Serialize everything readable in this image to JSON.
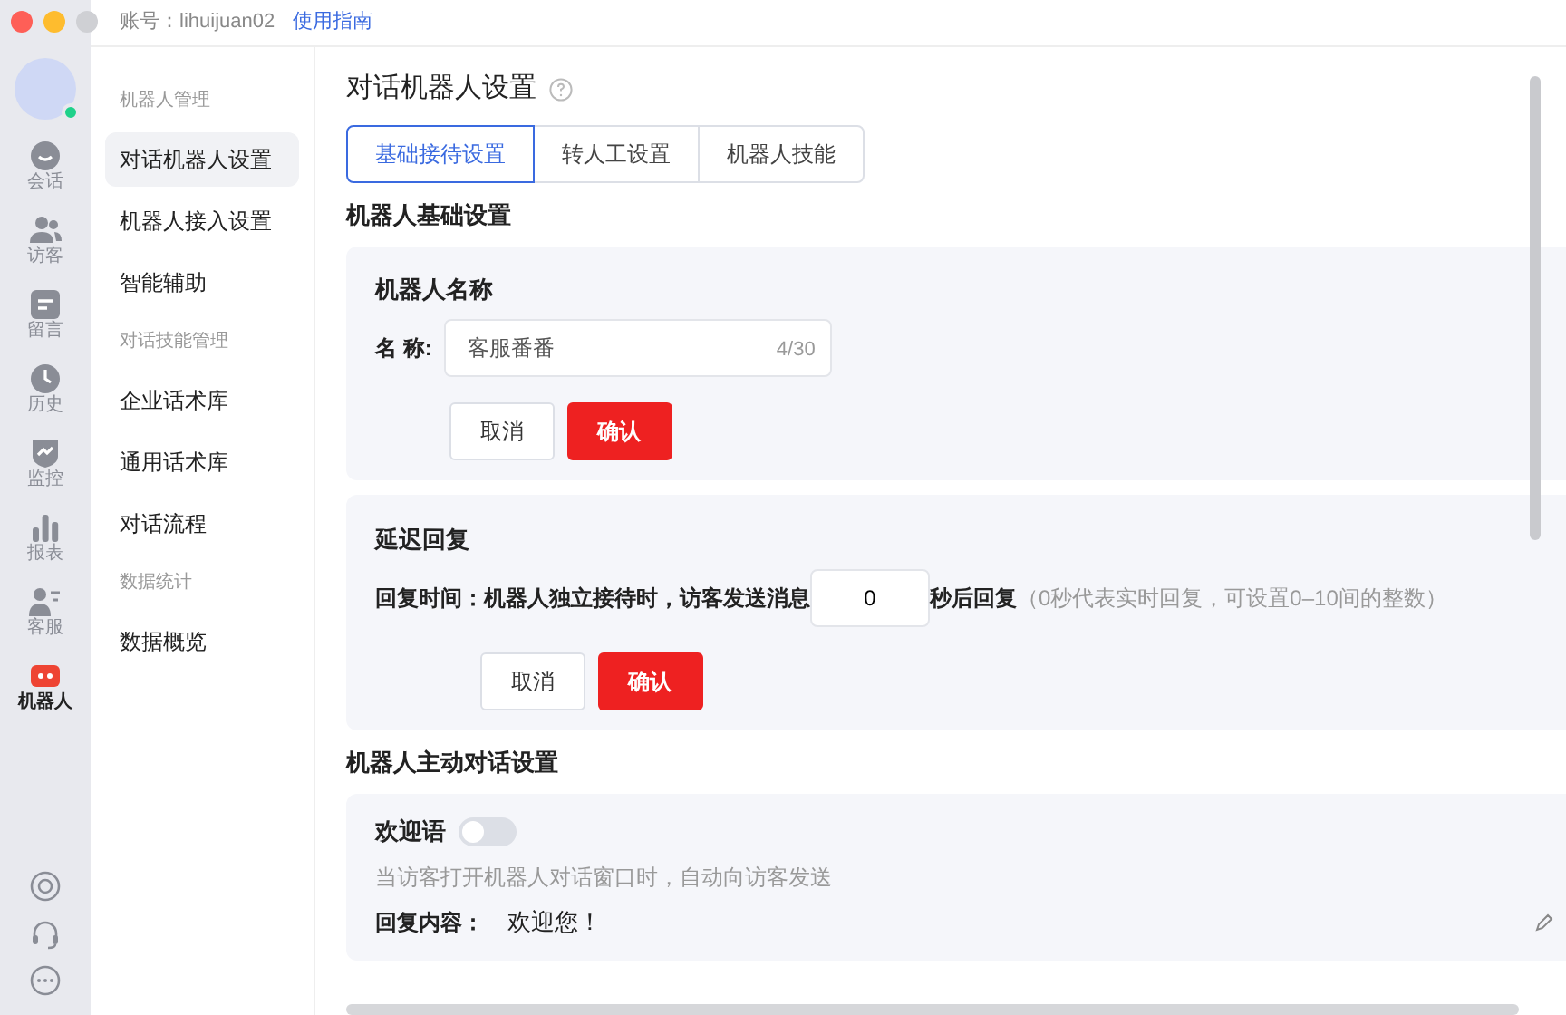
{
  "window": {
    "account_label": "账号：lihuijuan02",
    "guide_link": "使用指南"
  },
  "rail": {
    "items": [
      {
        "kind": "chat",
        "label": "会话",
        "selected": false
      },
      {
        "kind": "visitors",
        "label": "访客",
        "selected": false
      },
      {
        "kind": "message",
        "label": "留言",
        "selected": false
      },
      {
        "kind": "history",
        "label": "历史",
        "selected": false
      },
      {
        "kind": "monitor",
        "label": "监控",
        "selected": false
      },
      {
        "kind": "report",
        "label": "报表",
        "selected": false
      },
      {
        "kind": "agent",
        "label": "客服",
        "selected": false
      },
      {
        "kind": "robot",
        "label": "机器人",
        "selected": true
      }
    ]
  },
  "sidebar": {
    "groups": [
      {
        "title": "机器人管理",
        "items": [
          {
            "label": "对话机器人设置",
            "selected": true
          },
          {
            "label": "机器人接入设置",
            "selected": false
          },
          {
            "label": "智能辅助",
            "selected": false
          }
        ]
      },
      {
        "title": "对话技能管理",
        "items": [
          {
            "label": "企业话术库",
            "selected": false
          },
          {
            "label": "通用话术库",
            "selected": false
          },
          {
            "label": "对话流程",
            "selected": false
          }
        ]
      },
      {
        "title": "数据统计",
        "items": [
          {
            "label": "数据概览",
            "selected": false
          }
        ]
      }
    ]
  },
  "page": {
    "title": "对话机器人设置",
    "tabs": [
      {
        "label": "基础接待设置",
        "selected": true
      },
      {
        "label": "转人工设置",
        "selected": false
      },
      {
        "label": "机器人技能",
        "selected": false
      }
    ],
    "section_basic": "机器人基础设置",
    "name_card": {
      "title": "机器人名称",
      "field_label": "名 称:",
      "value": "客服番番",
      "counter": "4/30",
      "cancel": "取消",
      "confirm": "确认"
    },
    "delay_card": {
      "title": "延迟回复",
      "label_before": "回复时间：机器人独立接待时，访客发送消息",
      "value": "0",
      "label_after": "秒后回复",
      "hint": "（0秒代表实时回复，可设置0–10间的整数）",
      "cancel": "取消",
      "confirm": "确认"
    },
    "section_active": "机器人主动对话设置",
    "welcome_card": {
      "title": "欢迎语",
      "on": false,
      "description": "当访客打开机器人对话窗口时，自动向访客发送",
      "content_label": "回复内容：",
      "content_value": "欢迎您！"
    }
  }
}
